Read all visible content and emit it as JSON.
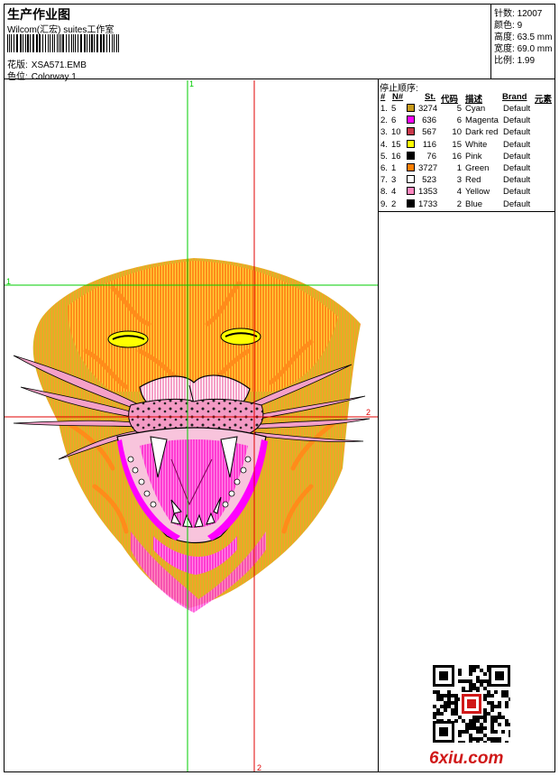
{
  "header": {
    "title": "生产作业图",
    "studio": "Wilcom(汇宏) suites工作室",
    "design_label": "花版:",
    "design_value": "XSA571.EMB",
    "colorway_label": "色位:",
    "colorway_value": "Colorway 1"
  },
  "stats": [
    {
      "label": "针数:",
      "value": "12007"
    },
    {
      "label": "颜色:",
      "value": "9"
    },
    {
      "label": "高度:",
      "value": "63.5 mm"
    },
    {
      "label": "宽度:",
      "value": "69.0 mm"
    },
    {
      "label": "比例:",
      "value": "1.99"
    }
  ],
  "stop_sequence": {
    "title": "停止顺序:",
    "headers": [
      "#",
      "N#",
      "St.",
      "代码",
      "描述",
      "Brand",
      "元素"
    ],
    "rows": [
      {
        "idx": "1.",
        "n": "5",
        "color": "#c79a1a",
        "st": "3274",
        "code": "5",
        "desc": "Cyan",
        "brand": "Default"
      },
      {
        "idx": "2.",
        "n": "6",
        "color": "#ff00ff",
        "st": "636",
        "code": "6",
        "desc": "Magenta",
        "brand": "Default"
      },
      {
        "idx": "3.",
        "n": "10",
        "color": "#c8384a",
        "st": "567",
        "code": "10",
        "desc": "Dark red",
        "brand": "Default"
      },
      {
        "idx": "4.",
        "n": "15",
        "color": "#ffff00",
        "st": "116",
        "code": "15",
        "desc": "White",
        "brand": "Default"
      },
      {
        "idx": "5.",
        "n": "16",
        "color": "#000000",
        "st": "76",
        "code": "16",
        "desc": "Pink",
        "brand": "Default"
      },
      {
        "idx": "6.",
        "n": "1",
        "color": "#ff7f00",
        "st": "3727",
        "code": "1",
        "desc": "Green",
        "brand": "Default"
      },
      {
        "idx": "7.",
        "n": "3",
        "color": "#ffffff",
        "st": "523",
        "code": "3",
        "desc": "Red",
        "brand": "Default"
      },
      {
        "idx": "8.",
        "n": "4",
        "color": "#ff88c0",
        "st": "1353",
        "code": "4",
        "desc": "Yellow",
        "brand": "Default"
      },
      {
        "idx": "9.",
        "n": "2",
        "color": "#000000",
        "st": "1733",
        "code": "2",
        "desc": "Blue",
        "brand": "Default"
      }
    ]
  },
  "guides": {
    "top_label": "1",
    "left_label": "1",
    "right_label": "2",
    "bottom_label": "2",
    "green": "#00cc00",
    "red": "#e00000"
  },
  "watermark": "6xiu.com",
  "colors": {
    "orange": "#ff8c1a",
    "gold": "#d9b526",
    "magenta": "#ff00ff",
    "pink": "#f5a0c8"
  }
}
